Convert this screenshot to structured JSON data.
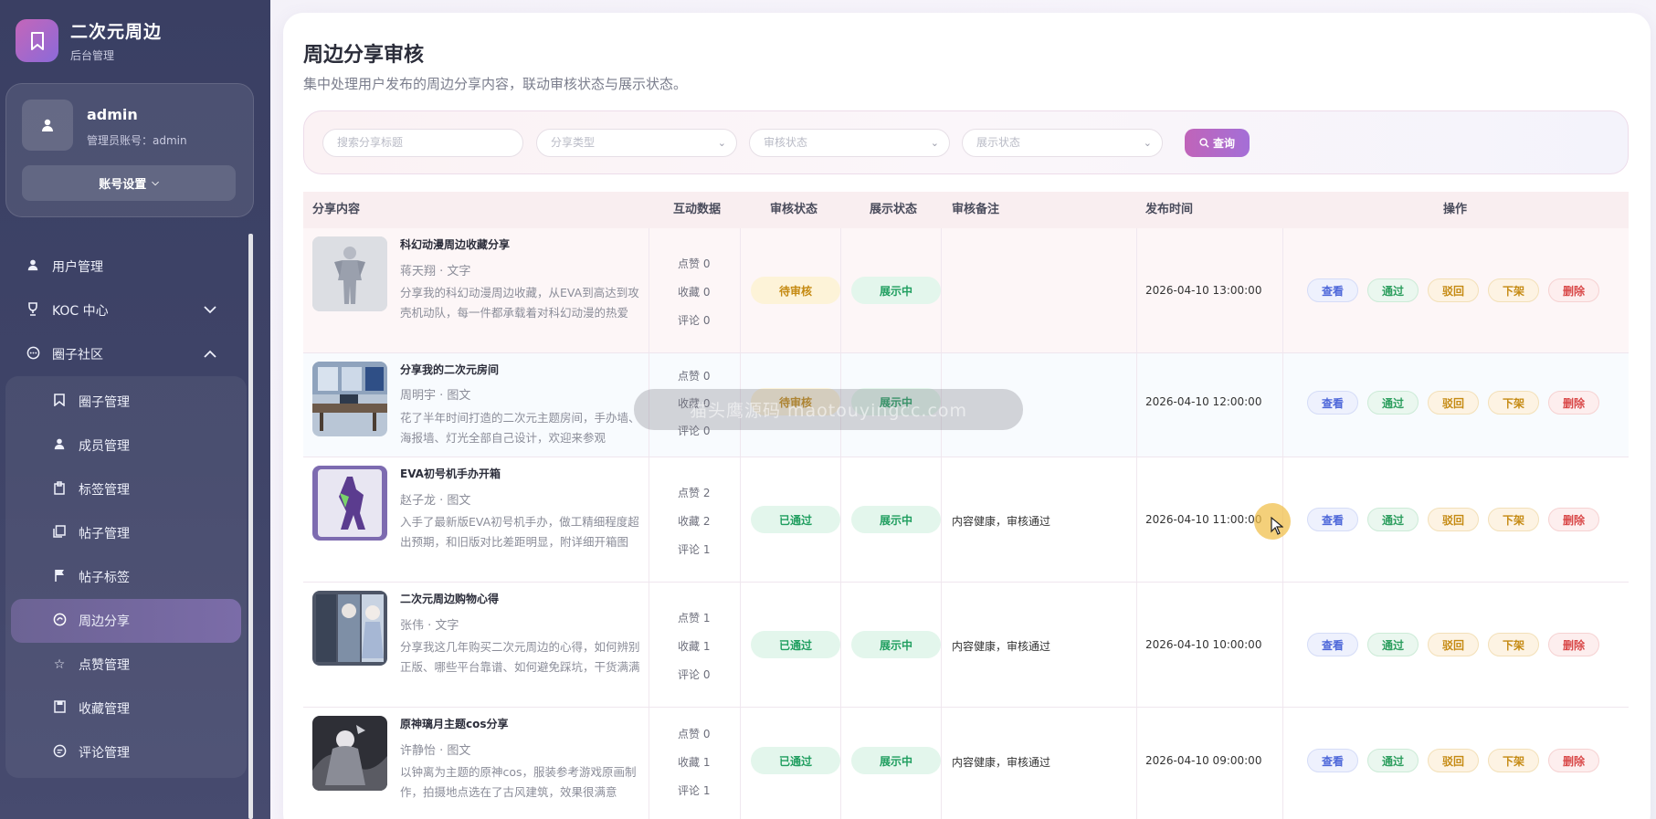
{
  "brand": {
    "name": "二次元周边",
    "subtitle": "后台管理"
  },
  "user": {
    "name": "admin",
    "account": "管理员账号：admin",
    "settings_label": "账号设置"
  },
  "menu": {
    "top_items": [
      {
        "label": "用户管理",
        "icon": "user-icon"
      },
      {
        "label": "KOC 中心",
        "icon": "cup-icon",
        "expanded": false
      },
      {
        "label": "圈子社区",
        "icon": "chat-icon",
        "expanded": true
      }
    ],
    "sub_items": [
      {
        "label": "圈子管理",
        "icon": "bookmark-icon"
      },
      {
        "label": "成员管理",
        "icon": "user-icon"
      },
      {
        "label": "标签管理",
        "icon": "tag-icon"
      },
      {
        "label": "帖子管理",
        "icon": "copy-icon"
      },
      {
        "label": "帖子标签",
        "icon": "flag-icon"
      },
      {
        "label": "周边分享",
        "icon": "share-icon",
        "active": true
      },
      {
        "label": "点赞管理",
        "icon": "star-icon"
      },
      {
        "label": "收藏管理",
        "icon": "save-icon"
      },
      {
        "label": "评论管理",
        "icon": "comment-icon"
      }
    ]
  },
  "page": {
    "title": "周边分享审核",
    "description": "集中处理用户发布的周边分享内容，联动审核状态与展示状态。"
  },
  "filters": {
    "search_placeholder": "搜索分享标题",
    "type_placeholder": "分享类型",
    "audit_placeholder": "审核状态",
    "display_placeholder": "展示状态",
    "query_label": "查询"
  },
  "table": {
    "headers": {
      "content": "分享内容",
      "stats": "互动数据",
      "audit": "审核状态",
      "display": "展示状态",
      "remark": "审核备注",
      "time": "发布时间",
      "ops": "操作"
    },
    "op_labels": {
      "view": "查看",
      "pass": "通过",
      "reject": "驳回",
      "off": "下架",
      "del": "删除"
    },
    "rows": [
      {
        "title": "科幻动漫周边收藏分享",
        "meta": "蒋天翔 · 文字",
        "desc": "分享我的科幻动漫周边收藏，从EVA到高达到攻壳机动队，每一件都承载着对科幻动漫的热爱",
        "likes": "点赞 0",
        "favs": "收藏 0",
        "comments": "评论 0",
        "audit": "待审核",
        "display": "展示中",
        "remark": "",
        "time": "2026-04-10 13:00:00"
      },
      {
        "title": "分享我的二次元房间",
        "meta": "周明宇 · 图文",
        "desc": "花了半年时间打造的二次元主题房间，手办墙、海报墙、灯光全部自己设计，欢迎来参观",
        "likes": "点赞 0",
        "favs": "收藏 0",
        "comments": "评论 0",
        "audit": "待审核",
        "display": "展示中",
        "remark": "",
        "time": "2026-04-10 12:00:00"
      },
      {
        "title": "EVA初号机手办开箱",
        "meta": "赵子龙 · 图文",
        "desc": "入手了最新版EVA初号机手办，做工精细程度超出预期，和旧版对比差距明显，附详细开箱图",
        "likes": "点赞 2",
        "favs": "收藏 2",
        "comments": "评论 1",
        "audit": "已通过",
        "display": "展示中",
        "remark": "内容健康，审核通过",
        "time": "2026-04-10 11:00:00"
      },
      {
        "title": "二次元周边购物心得",
        "meta": "张伟 · 文字",
        "desc": "分享我这几年购买二次元周边的心得，如何辨别正版、哪些平台靠谱、如何避免踩坑，干货满满",
        "likes": "点赞 1",
        "favs": "收藏 1",
        "comments": "评论 0",
        "audit": "已通过",
        "display": "展示中",
        "remark": "内容健康，审核通过",
        "time": "2026-04-10 10:00:00"
      },
      {
        "title": "原神璃月主题cos分享",
        "meta": "许静怡 · 图文",
        "desc": "以钟离为主题的原神cos，服装参考游戏原画制作，拍摄地点选在了古风建筑，效果很满意",
        "likes": "点赞 0",
        "favs": "收藏 1",
        "comments": "评论 1",
        "audit": "已通过",
        "display": "展示中",
        "remark": "内容健康，审核通过",
        "time": "2026-04-10 09:00:00"
      }
    ]
  },
  "watermark": {
    "text": "猫头鹰源码 maotouyingcc.com"
  },
  "colors": {
    "accent": "#b96bc4",
    "sidebar": "#3d4266",
    "pending": "#c58a12",
    "passed": "#1f9e5f"
  }
}
